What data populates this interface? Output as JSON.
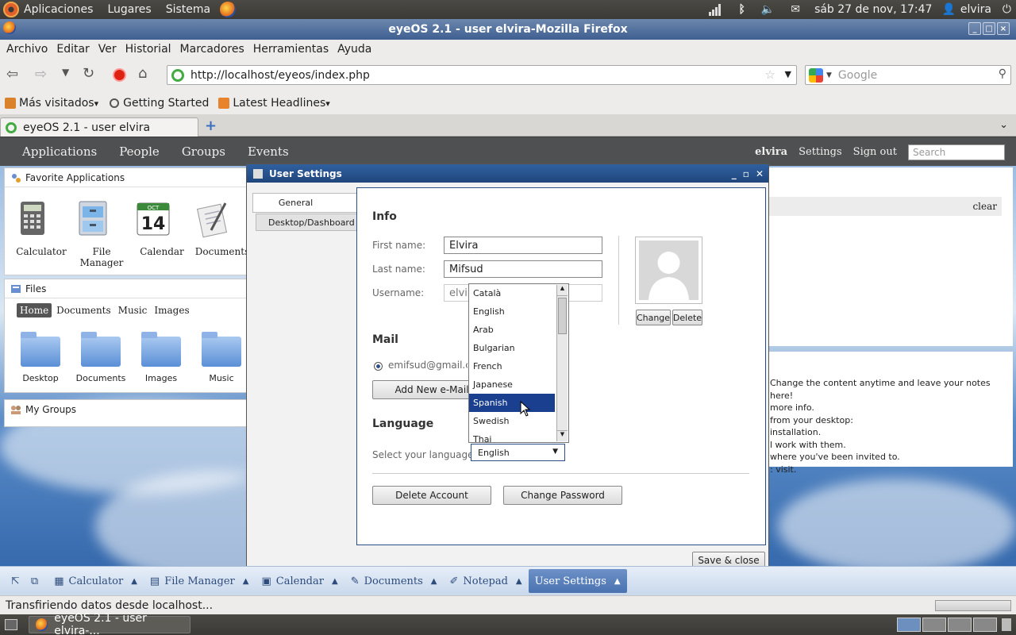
{
  "gnome_panel": {
    "menus": [
      "Aplicaciones",
      "Lugares",
      "Sistema"
    ],
    "datetime": "sáb 27 de nov, 17:47",
    "user": "elvira"
  },
  "firefox": {
    "window_title": "eyeOS 2.1 - user elvira-Mozilla Firefox",
    "menu": [
      "Archivo",
      "Editar",
      "Ver",
      "Historial",
      "Marcadores",
      "Herramientas",
      "Ayuda"
    ],
    "url": "http://localhost/eyeos/index.php",
    "search_placeholder": "Google",
    "bookmarks": [
      "Más visitados",
      "Getting Started",
      "Latest Headlines"
    ],
    "tab_title": "eyeOS 2.1 - user elvira",
    "status": "Transfiriendo datos desde localhost..."
  },
  "eyeos": {
    "nav": [
      "Applications",
      "People",
      "Groups",
      "Events"
    ],
    "user": "elvira",
    "settings": "Settings",
    "signout": "Sign out",
    "search_placeholder": "Search",
    "favorites_title": "Favorite Applications",
    "favorites": [
      "Calculator",
      "File Manager",
      "Calendar",
      "Documents"
    ],
    "calendar_icon_num": "14",
    "calendar_icon_month": "OCT",
    "files_title": "Files",
    "files_tabs": [
      "Home",
      "Documents",
      "Music",
      "Images"
    ],
    "folders": [
      "Desktop",
      "Documents",
      "Images",
      "Music"
    ],
    "groups_title": "My Groups",
    "clear": "clear",
    "notes": [
      "Change the content anytime and leave your notes here!",
      "more info.",
      "from your desktop:",
      "installation.",
      "l work with them.",
      "where you've been invited to.",
      ": visit."
    ]
  },
  "settings": {
    "title": "User Settings",
    "tabs": [
      "General",
      "Desktop/Dashboard"
    ],
    "info_title": "Info",
    "first_name_label": "First name:",
    "first_name": "Elvira",
    "last_name_label": "Last name:",
    "last_name": "Mifsud",
    "username_label": "Username:",
    "username": "elvira",
    "change": "Change",
    "delete": "Delete",
    "mail_title": "Mail",
    "email": "emifsud@gmail.com",
    "add_email": "Add New e-Mail",
    "language_title": "Language",
    "select_language": "Select your language:",
    "language_value": "English",
    "language_options": [
      "Català",
      "English",
      "Arab",
      "Bulgarian",
      "French",
      "Japanese",
      "Spanish",
      "Swedish",
      "Thai"
    ],
    "language_highlight": "Spanish",
    "delete_account": "Delete Account",
    "change_password": "Change Password",
    "save_close": "Save & close"
  },
  "taskbar": [
    "Calculator",
    "File Manager",
    "Calendar",
    "Documents",
    "Notepad",
    "User Settings"
  ],
  "gnome_bottom": {
    "task": "eyeOS 2.1 - user elvira-..."
  }
}
